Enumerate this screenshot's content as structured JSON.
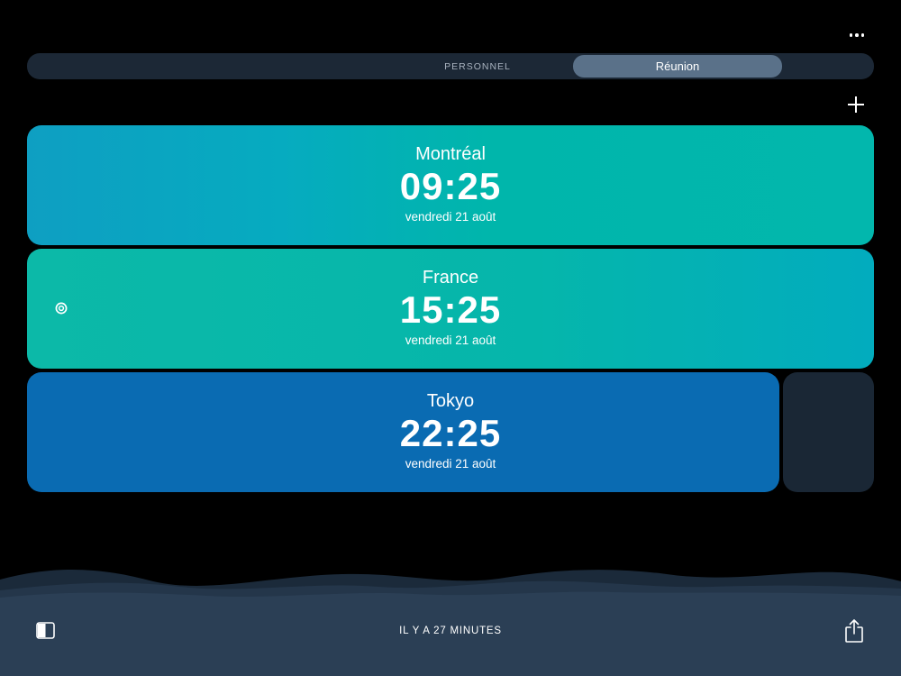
{
  "toolbar": {
    "more_icon": "ellipsis-icon",
    "add_icon": "plus-icon"
  },
  "segments": {
    "personal": "PERSONNEL",
    "meeting": "Réunion",
    "selected": "Réunion"
  },
  "clocks": [
    {
      "city": "Montréal",
      "time": "09:25",
      "date": "vendredi 21 août",
      "color": "#0e9fc2"
    },
    {
      "city": "France",
      "time": "15:25",
      "date": "vendredi 21 août",
      "color": "#0cb9a8",
      "current_location": true
    },
    {
      "city": "Tokyo",
      "time": "22:25",
      "date": "vendredi 21 août",
      "color": "#0a6bb2"
    }
  ],
  "footer": {
    "time_offset": "IL Y A 27 MINUTES",
    "left_icon": "sidebar-toggle-icon",
    "right_icon": "share-icon"
  },
  "colors": {
    "background": "#000000",
    "segmented_bg": "#1c2836",
    "segment_selected": "#5a7189",
    "footer_bg": "#2a3d52"
  }
}
